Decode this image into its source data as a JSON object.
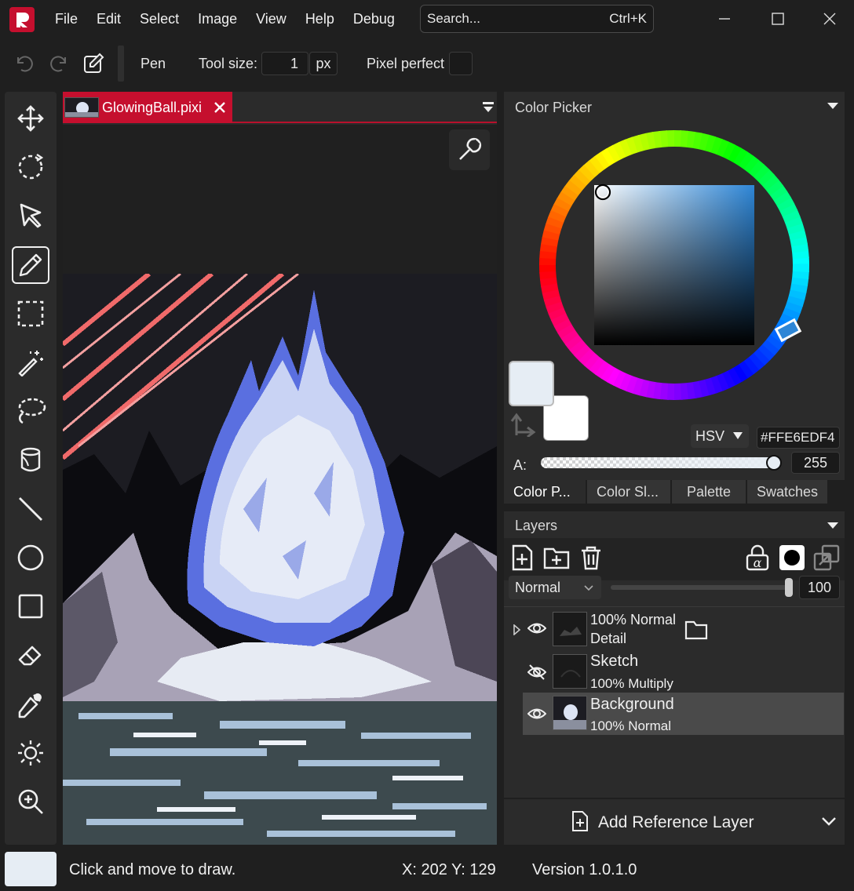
{
  "menu": {
    "items": [
      "File",
      "Edit",
      "Select",
      "Image",
      "View",
      "Help",
      "Debug"
    ]
  },
  "search": {
    "placeholder": "Search...",
    "shortcut": "Ctrl+K"
  },
  "toolbar": {
    "tool_name": "Pen",
    "tool_size_label": "Tool size:",
    "tool_size_value": "1",
    "tool_size_unit": "px",
    "pixel_perfect_label": "Pixel perfect"
  },
  "tools": [
    "move-icon",
    "rotate-icon",
    "select-pointer-icon",
    "pen-icon",
    "rect-select-icon",
    "magic-wand-icon",
    "lasso-icon",
    "bucket-icon",
    "line-icon",
    "ellipse-icon",
    "rectangle-icon",
    "eraser-icon",
    "color-picker-icon",
    "brightness-icon",
    "zoom-icon"
  ],
  "document": {
    "tab_title": "GlowingBall.pixi"
  },
  "color_picker": {
    "title": "Color Picker",
    "mode": "HSV",
    "hex": "#FFE6EDF4",
    "alpha_label": "A:",
    "alpha_value": "255",
    "primary_color": "#e6edf4",
    "secondary_color": "#ffffff",
    "hue_color": "#2e86d6",
    "alpha_level": 1.0
  },
  "picker_tabs": [
    "Color P...",
    "Color Sl...",
    "Palette",
    "Swatches"
  ],
  "layers": {
    "title": "Layers",
    "blend_mode": "Normal",
    "opacity": "100",
    "items": [
      {
        "line1": "100% Normal",
        "line2": "Detail"
      },
      {
        "line1": "Sketch",
        "line2": "100% Multiply"
      },
      {
        "line1": "Background",
        "line2": "100% Normal"
      }
    ],
    "add_reference": "Add Reference Layer"
  },
  "status": {
    "message": "Click and move to draw.",
    "coords": "X: 202 Y: 129",
    "version": "Version 1.0.1.0"
  },
  "accent": "#c50f2e"
}
